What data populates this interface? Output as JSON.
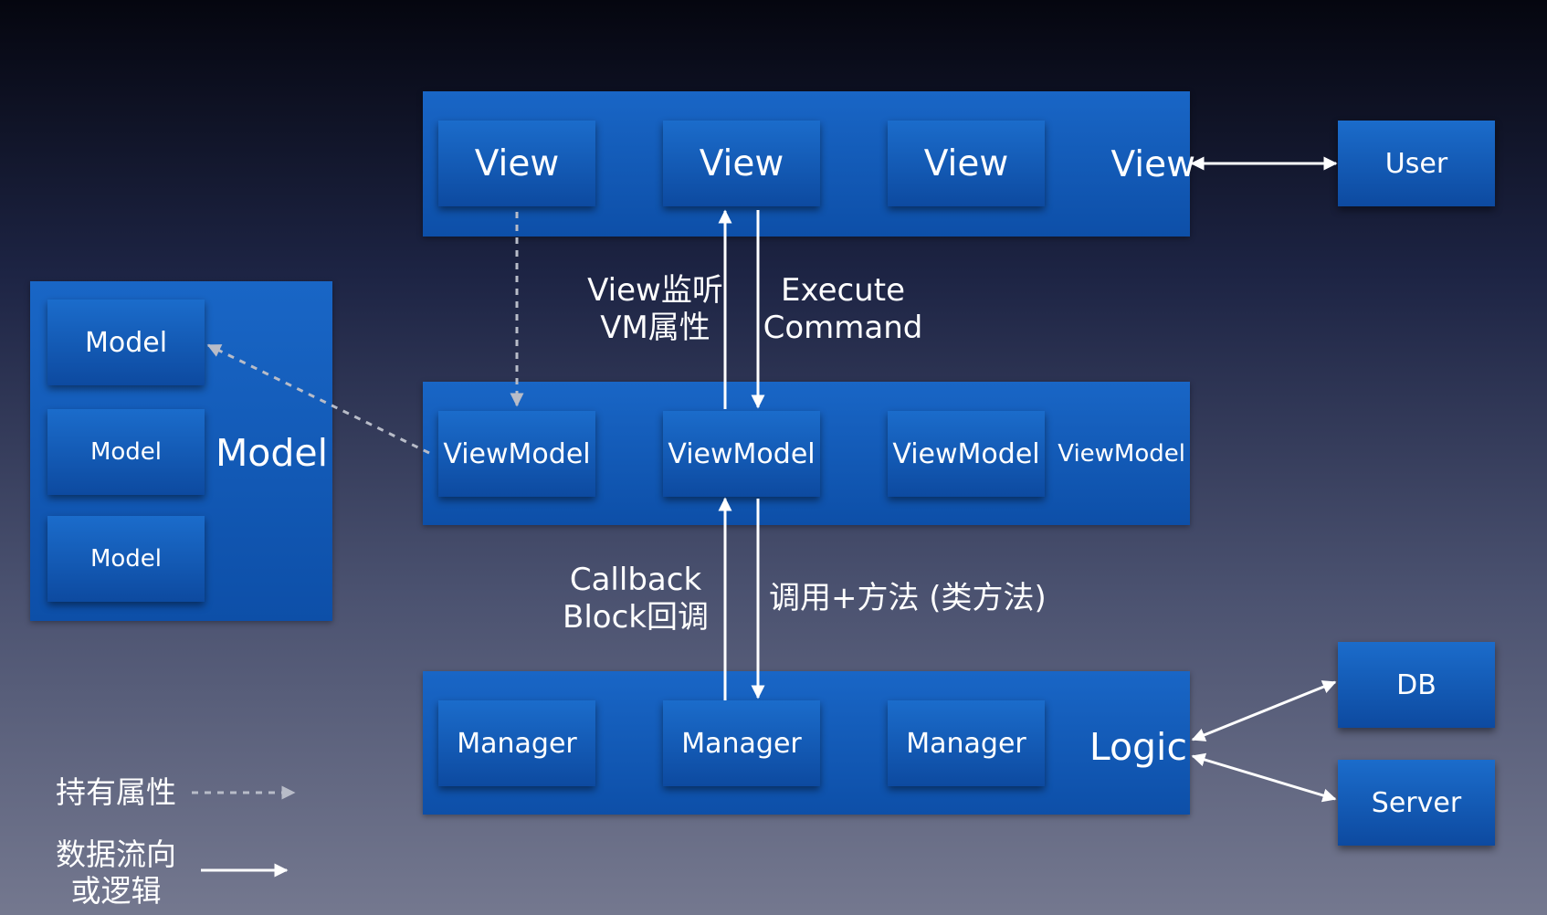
{
  "view_layer": {
    "views": [
      "View",
      "View",
      "View"
    ],
    "label": "View"
  },
  "user": "User",
  "viewmodel_layer": {
    "viewmodels": [
      "ViewModel",
      "ViewModel",
      "ViewModel"
    ],
    "label": "ViewModel"
  },
  "model_layer": {
    "models": [
      "Model",
      "Model",
      "Model"
    ],
    "label": "Model"
  },
  "logic_layer": {
    "managers": [
      "Manager",
      "Manager",
      "Manager"
    ],
    "label": "Logic"
  },
  "db": "DB",
  "server": "Server",
  "annotations": {
    "view_observe": [
      "View监听",
      "VM属性"
    ],
    "execute_command": [
      "Execute",
      "Command"
    ],
    "callback": [
      "Callback",
      "Block回调"
    ],
    "invoke": "调用+方法 (类方法)"
  },
  "legend": {
    "holds_property": "持有属性",
    "data_flow": [
      "数据流向",
      "或逻辑"
    ]
  },
  "colors": {
    "box_blue": "#1565c0",
    "arrow": "#ffffff",
    "dashed_arrow": "#b8bcc8"
  }
}
